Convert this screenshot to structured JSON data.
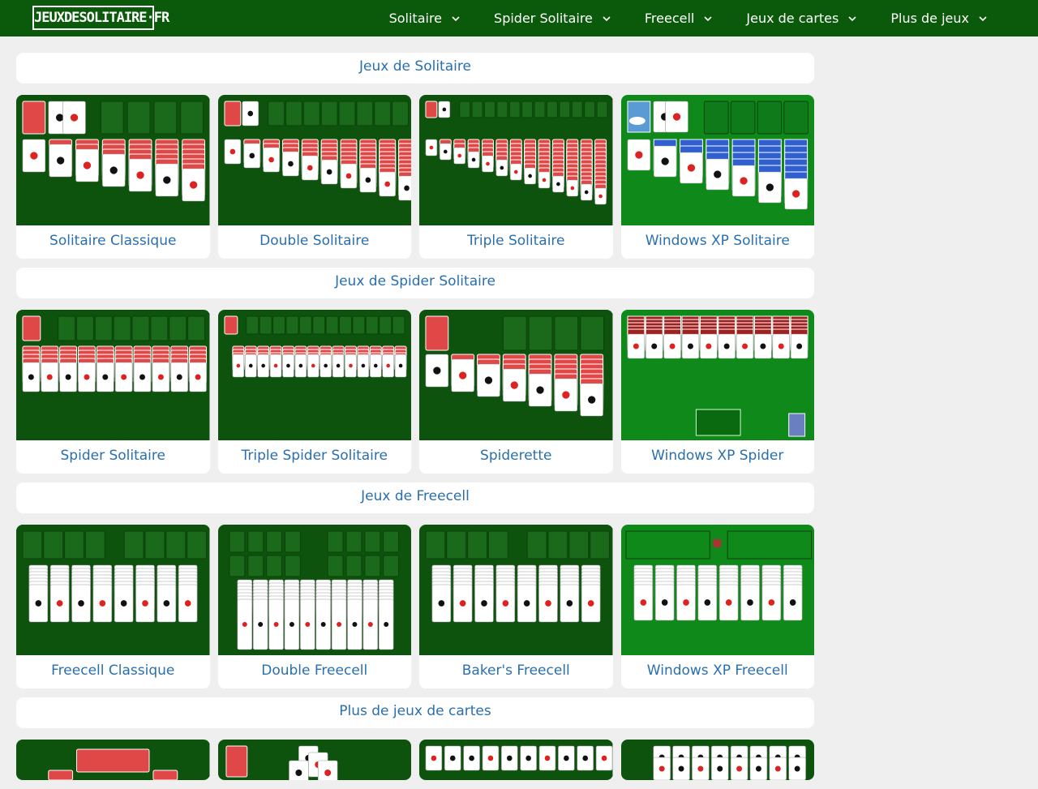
{
  "header": {
    "logo": "JEUXDESOLITAIRE·FR",
    "nav": [
      "Solitaire",
      "Spider Solitaire",
      "Freecell",
      "Jeux de cartes",
      "Plus de jeux"
    ]
  },
  "sections": [
    {
      "title": "Jeux de Solitaire",
      "games": [
        "Solitaire Classique",
        "Double Solitaire",
        "Triple Solitaire",
        "Windows XP Solitaire"
      ]
    },
    {
      "title": "Jeux de Spider Solitaire",
      "games": [
        "Spider Solitaire",
        "Triple Spider Solitaire",
        "Spiderette",
        "Windows XP Spider"
      ]
    },
    {
      "title": "Jeux de Freecell",
      "games": [
        "Freecell Classique",
        "Double Freecell",
        "Baker's Freecell",
        "Windows XP Freecell"
      ]
    },
    {
      "title": "Plus de jeux de cartes",
      "games": []
    }
  ],
  "colors": {
    "header_bg": "#0b5a0b",
    "felt": "#0d520d",
    "xp_felt": "#0f8a1a",
    "link": "#2a6fad",
    "card_back": "#e04848"
  }
}
